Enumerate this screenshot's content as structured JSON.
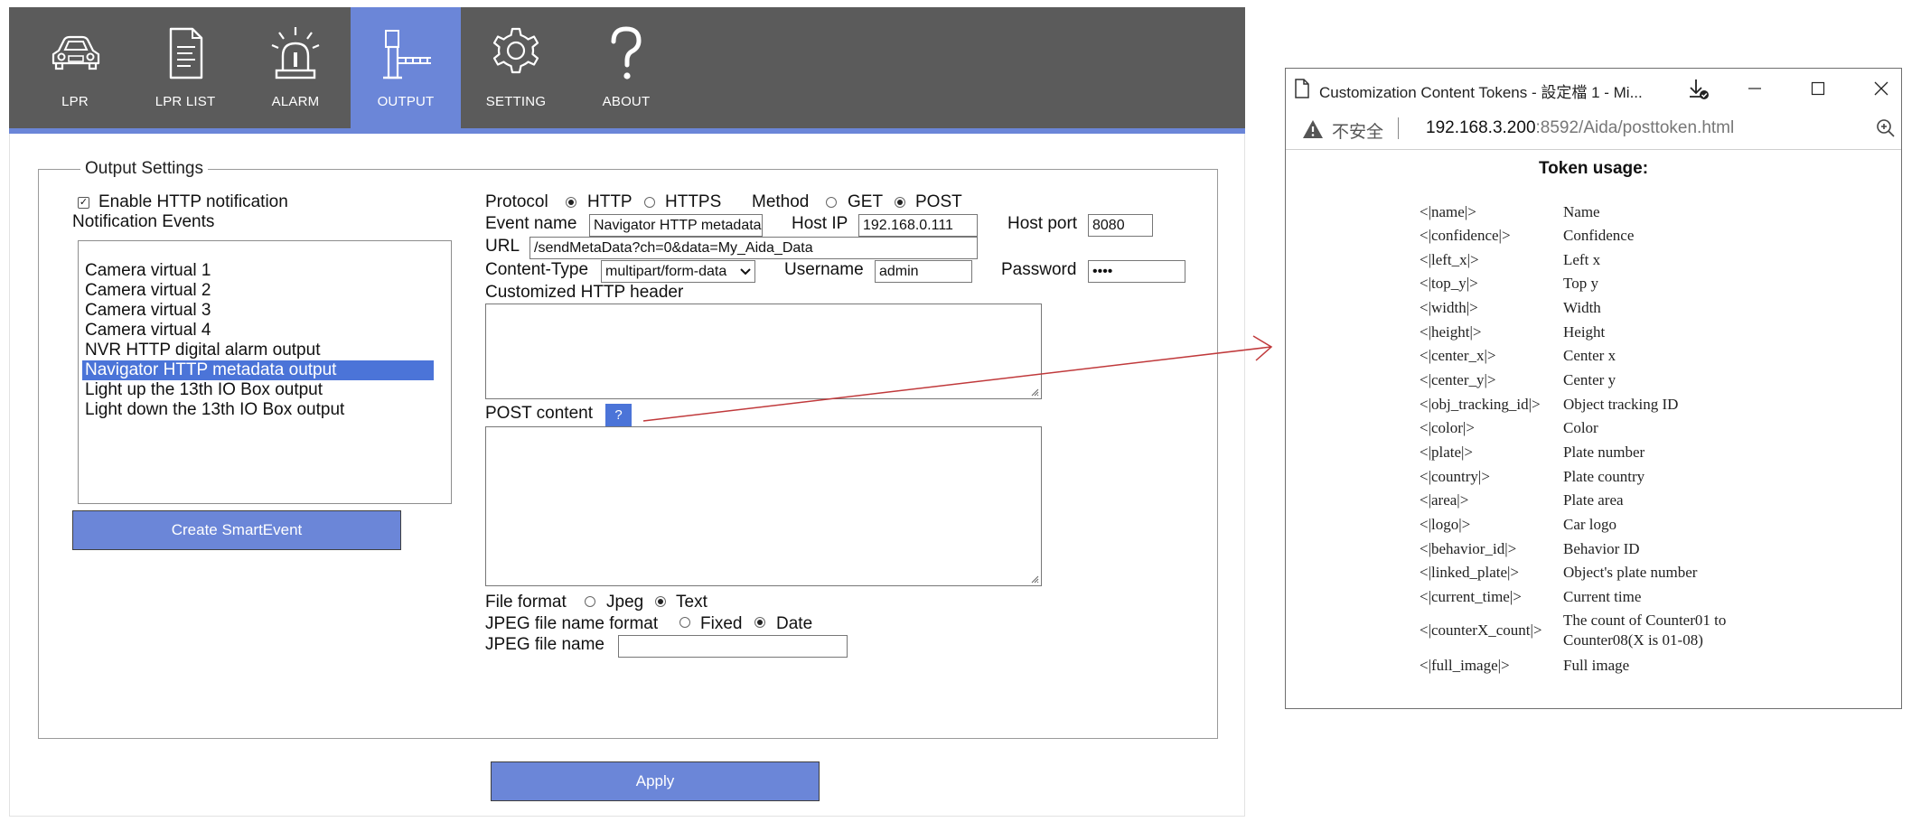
{
  "nav": {
    "items": [
      {
        "label": "LPR",
        "icon": "car-icon"
      },
      {
        "label": "LPR LIST",
        "icon": "document-list-icon"
      },
      {
        "label": "ALARM",
        "icon": "siren-icon"
      },
      {
        "label": "OUTPUT",
        "icon": "barrier-gate-icon",
        "active": true
      },
      {
        "label": "SETTING",
        "icon": "gear-icon"
      },
      {
        "label": "ABOUT",
        "icon": "question-mark-icon"
      }
    ]
  },
  "output_settings": {
    "legend": "Output Settings",
    "enable_http_label": "Enable HTTP notification",
    "enable_http_checked": true,
    "events_label": "Notification Events",
    "events": [
      "Camera virtual 1",
      "Camera virtual 2",
      "Camera virtual 3",
      "Camera virtual 4",
      "NVR HTTP digital alarm output",
      "Navigator HTTP metadata output",
      "Light up the 13th IO Box output",
      "Light down the 13th IO Box output"
    ],
    "selected_event": "Navigator HTTP metadata output",
    "create_smartevent_label": "Create SmartEvent",
    "protocol_label": "Protocol",
    "protocol_options": [
      "HTTP",
      "HTTPS"
    ],
    "protocol_selected": "HTTP",
    "method_label": "Method",
    "method_options": [
      "GET",
      "POST"
    ],
    "method_selected": "POST",
    "event_name_label": "Event name",
    "event_name_value": "Navigator HTTP metadata output",
    "host_ip_label": "Host IP",
    "host_ip_value": "192.168.0.111",
    "host_port_label": "Host port",
    "host_port_value": "8080",
    "url_label": "URL",
    "url_value": "/sendMetaData?ch=0&data=My_Aida_Data",
    "content_type_label": "Content-Type",
    "content_type_value": "multipart/form-data",
    "username_label": "Username",
    "username_value": "admin",
    "password_label": "Password",
    "password_value": "••••",
    "custom_header_label": "Customized HTTP header",
    "post_content_label": "POST content",
    "help_button_label": "?",
    "file_format_label": "File format",
    "file_format_options": [
      "Jpeg",
      "Text"
    ],
    "file_format_selected": "Text",
    "jpeg_name_format_label": "JPEG file name format",
    "jpeg_name_format_options": [
      "Fixed",
      "Date"
    ],
    "jpeg_name_format_selected": "Date",
    "jpeg_name_label": "JPEG file name",
    "jpeg_name_value": ""
  },
  "apply_label": "Apply",
  "popup": {
    "title": "Customization Content Tokens - 設定檔 1 - Mi...",
    "security_label": "不安全",
    "url_host": "192.168.3.200",
    "url_rest": ":8592/Aida/posttoken.html",
    "heading": "Token usage:",
    "tokens": [
      {
        "token": "<|name|>",
        "desc": "Name"
      },
      {
        "token": "<|confidence|>",
        "desc": "Confidence"
      },
      {
        "token": "<|left_x|>",
        "desc": "Left x"
      },
      {
        "token": "<|top_y|>",
        "desc": "Top y"
      },
      {
        "token": "<|width|>",
        "desc": "Width"
      },
      {
        "token": "<|height|>",
        "desc": "Height"
      },
      {
        "token": "<|center_x|>",
        "desc": "Center x"
      },
      {
        "token": "<|center_y|>",
        "desc": "Center y"
      },
      {
        "token": "<|obj_tracking_id|>",
        "desc": "Object tracking ID"
      },
      {
        "token": "<|color|>",
        "desc": "Color"
      },
      {
        "token": "<|plate|>",
        "desc": "Plate number"
      },
      {
        "token": "<|country|>",
        "desc": "Plate country"
      },
      {
        "token": "<|area|>",
        "desc": "Plate area"
      },
      {
        "token": "<|logo|>",
        "desc": "Car logo"
      },
      {
        "token": "<|behavior_id|>",
        "desc": "Behavior ID"
      },
      {
        "token": "<|linked_plate|>",
        "desc": "Object's plate number"
      },
      {
        "token": "<|current_time|>",
        "desc": "Current time"
      },
      {
        "token": "<|counterX_count|>",
        "desc": "The count of Counter01 to",
        "desc2": "Counter08(X is 01-08)"
      },
      {
        "token": "<|full_image|>",
        "desc": "Full image"
      }
    ]
  },
  "colors": {
    "topbar": "#5b5b5b",
    "accent": "#6b86d8",
    "selection": "#4b74d8",
    "arrow": "#c0393b"
  }
}
